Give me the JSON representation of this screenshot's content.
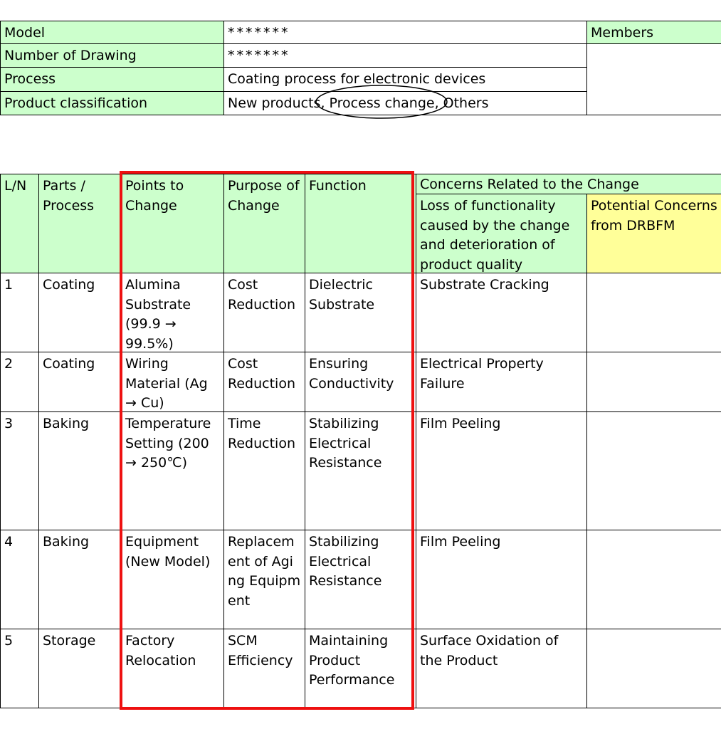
{
  "header": {
    "rows": [
      {
        "label": "Model",
        "value": "*******"
      },
      {
        "label": "Number of Drawing",
        "value": "*******"
      },
      {
        "label": "Process",
        "value": "Coating process for electronic devices"
      },
      {
        "label": "Product classification",
        "value": "New products, Process change, Others"
      }
    ],
    "members_label": "Members"
  },
  "table": {
    "headers": {
      "ln": "L/N",
      "parts": "Parts / Process",
      "points": "Points to Change",
      "purpose": "Purpose of Change",
      "function": "Function",
      "concerns": "Concerns Related to the Change",
      "loss": "Loss of functionality caused by the change and deterioration of product quality",
      "potential": "Potential Concerns from DRBFM"
    },
    "rows": [
      {
        "ln": "1",
        "parts": "Coating",
        "points": "Alumina Substrate (99.9 → 99.5%)",
        "purpose": "Cost Reduction",
        "function": "Dielectric Substrate",
        "loss": "Substrate Cracking",
        "potential": ""
      },
      {
        "ln": "2",
        "parts": "Coating",
        "points": "Wiring Material (Ag → Cu)",
        "purpose": "Cost Reduction",
        "function": "Ensuring Conductivity",
        "loss": "Electrical Property Failure",
        "potential": ""
      },
      {
        "ln": "3",
        "parts": "Baking",
        "points": "Temperature Setting (200 → 250℃)",
        "purpose": "Time Reduction",
        "function": "Stabilizing Electrical Resistance",
        "loss": "Film Peeling",
        "potential": ""
      },
      {
        "ln": "4",
        "parts": "Baking",
        "points": "Equipment (New Model)",
        "purpose": "Replacement of Aging Equipment",
        "function": "Stabilizing Electrical Resistance",
        "loss": "Film Peeling",
        "potential": ""
      },
      {
        "ln": "5",
        "parts": "Storage",
        "points": "Factory Relocation",
        "purpose": "SCM Efficiency",
        "function": "Maintaining Product Performance",
        "loss": "Surface Oxidation of the Product",
        "potential": ""
      }
    ]
  },
  "colors": {
    "header_green": "#ccffcc",
    "header_yellow": "#ffff99",
    "highlight_red": "#ee1111"
  }
}
